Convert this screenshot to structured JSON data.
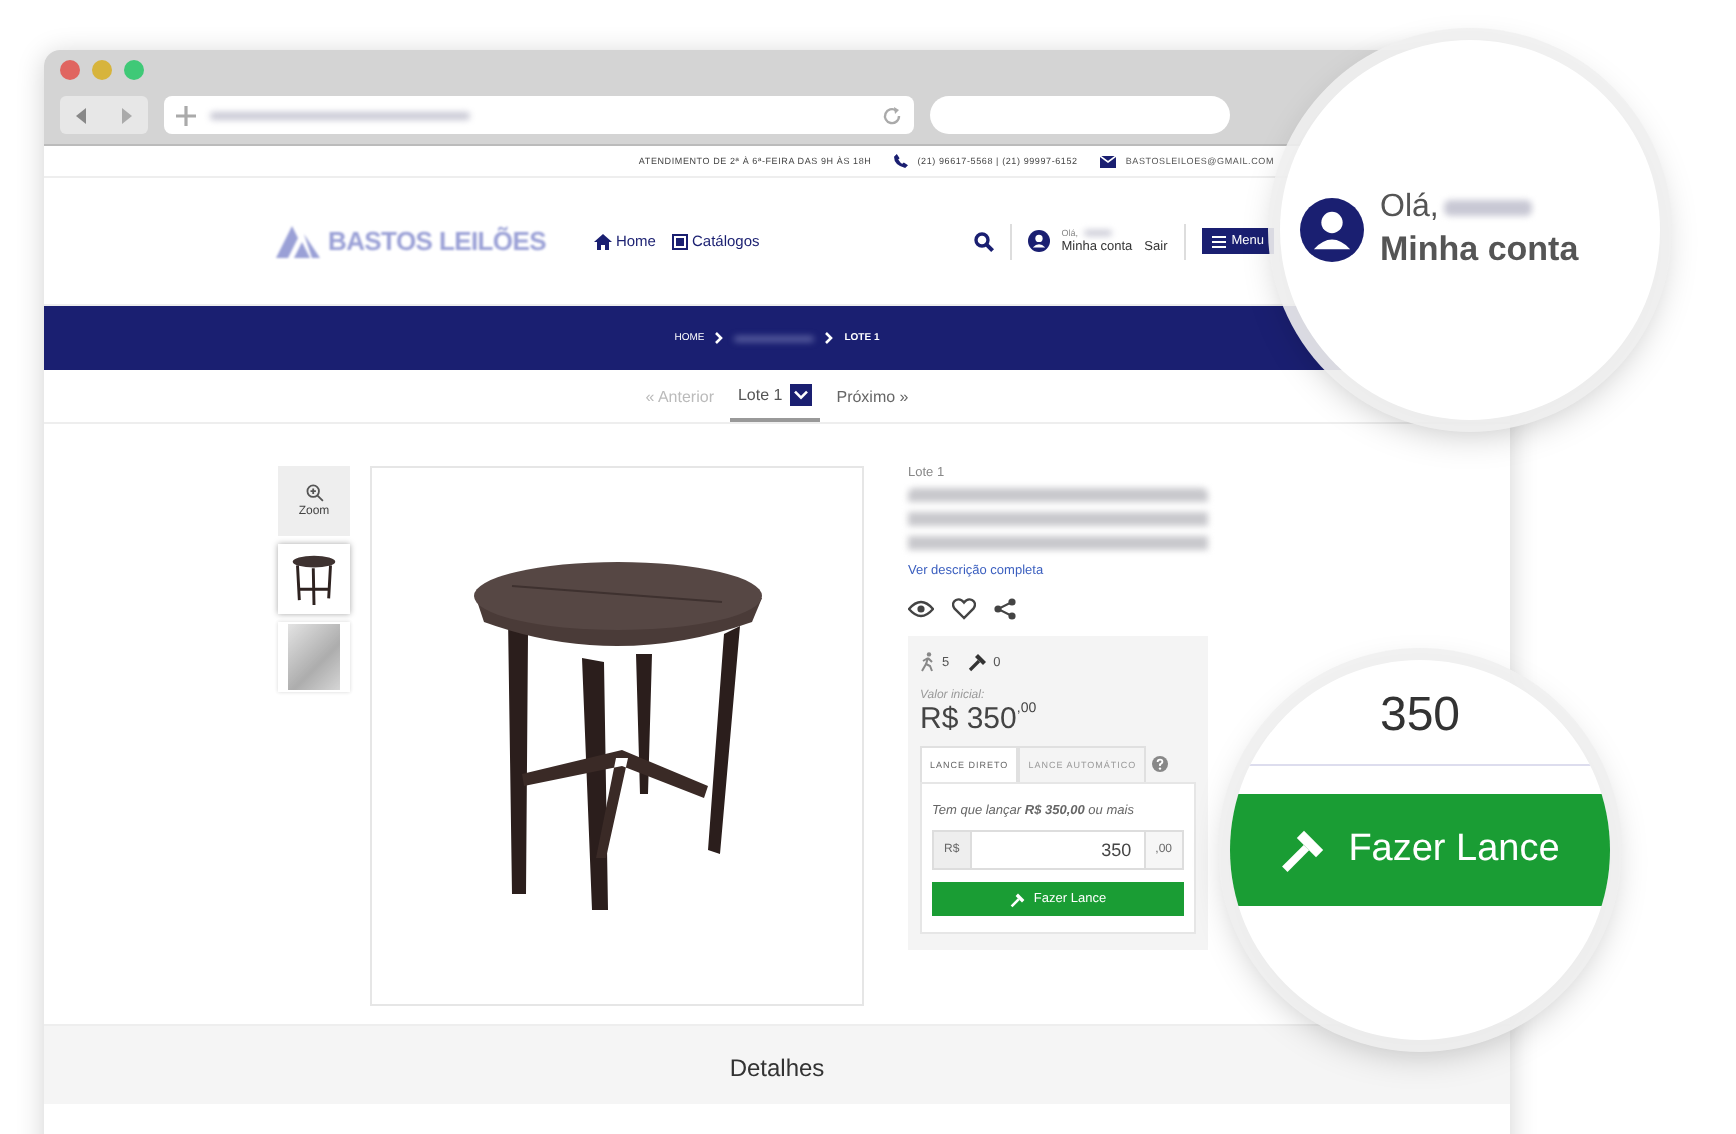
{
  "top_bar": {
    "hours": "ATENDIMENTO DE 2ª À 6ª-FEIRA DAS 9H ÀS 18H",
    "phones": "(21) 96617-5568 | (21) 99997-6152",
    "email": "BASTOSLEILOES@GMAIL.COM"
  },
  "header": {
    "logo": "BASTOS LEILÕES",
    "nav": [
      {
        "label": "Home"
      },
      {
        "label": "Catálogos"
      }
    ],
    "account": {
      "greeting": "Olá,",
      "link": "Minha conta",
      "logout": "Sair"
    },
    "menu_button": "Menu"
  },
  "breadcrumb": [
    {
      "label": "HOME",
      "current": false
    },
    {
      "label": "LOTE 1",
      "current": true
    }
  ],
  "pager": {
    "previous": {
      "label": "« Anterior",
      "disabled": true
    },
    "current": "Lote 1",
    "next": {
      "label": "Próximo »",
      "disabled": false
    }
  },
  "gallery": {
    "zoom": "Zoom",
    "thumbnails": [
      {
        "kind": "table",
        "selected": true
      },
      {
        "kind": "photo",
        "selected": false
      }
    ]
  },
  "lot": {
    "label": "Lote 1",
    "link": "Ver descrição completa",
    "viewers": "5",
    "bids": "0",
    "initial_label": "Valor inicial:",
    "price": "R$ 350",
    "cents": ",00",
    "tabs": [
      {
        "label": "LANCE DIRETO",
        "selected": true
      },
      {
        "label": "LANCE AUTOMÁTICO",
        "selected": false
      }
    ],
    "hint": "Tem que lançar **R$ 350,00** ou mais",
    "currency": "R$",
    "value": "350",
    "decimals": ",00",
    "button": "Fazer Lance"
  },
  "magnifiers": {
    "account": {
      "greeting": "Olá,",
      "link": "Minha conta"
    },
    "bid": {
      "value": "350",
      "button": "Fazer Lance"
    }
  },
  "details": {
    "title": "Detalhes"
  }
}
